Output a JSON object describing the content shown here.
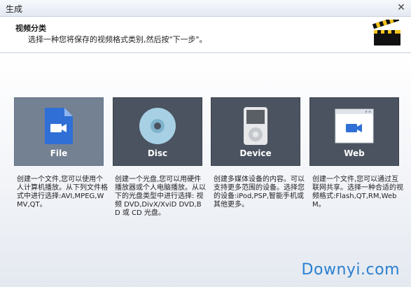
{
  "window": {
    "title": "生成",
    "close_glyph": "✕"
  },
  "header": {
    "title": "视频分类",
    "subtitle": "选择一种您将保存的视频格式类别,然后按\"下一步\"。",
    "icon": "clapperboard-icon"
  },
  "categories": [
    {
      "label": "File",
      "icon": "video-file-icon",
      "selected": true,
      "description": "创建一个文件,您可以使用个人计算机播放。从下列文件格式中进行选择:AVI,MPEG,WMV,QT。"
    },
    {
      "label": "Disc",
      "icon": "disc-icon",
      "selected": false,
      "description": "创建一个光盘,您可以用硬件播放器或个人电脑播放。从以下的光盘类型中进行选择: 视频 DVD,DivX/XviD DVD,BD 或 CD 光盘。"
    },
    {
      "label": "Device",
      "icon": "media-player-icon",
      "selected": false,
      "description": "创建多媒体设备的内容。可以支持更多范围的设备。选择您的设备:iPod,PSP,智能手机或其他更多。"
    },
    {
      "label": "Web",
      "icon": "web-video-icon",
      "selected": false,
      "description": "创建一个文件,您可以通过互联网共享。选择一种合适的视频格式:Flash,QT,RM,WebM。"
    }
  ],
  "watermark": "Downyi.com",
  "colors": {
    "card": "#4b5360",
    "card_selected": "#738192",
    "accent_blue": "#2f6fd6"
  }
}
